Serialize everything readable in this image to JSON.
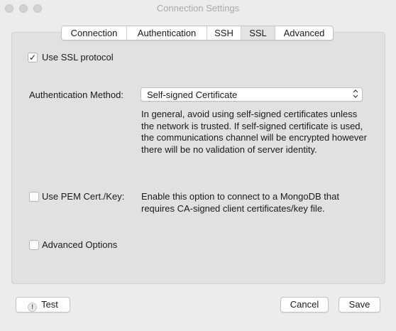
{
  "window": {
    "title": "Connection Settings"
  },
  "tabs": [
    {
      "label": "Connection"
    },
    {
      "label": "Authentication"
    },
    {
      "label": "SSH"
    },
    {
      "label": "SSL"
    },
    {
      "label": "Advanced"
    }
  ],
  "active_tab": "SSL",
  "ssl": {
    "use_ssl_label": "Use SSL protocol",
    "use_ssl_checked": true,
    "auth_method_label": "Authentication Method:",
    "auth_method_value": "Self-signed Certificate",
    "auth_method_help": "In general, avoid using self-signed certificates unless the network is trusted. If self-signed certificate is used, the communications channel will be encrypted however there will be no validation of server identity.",
    "pem_label": "Use PEM Cert./Key:",
    "pem_checked": false,
    "pem_help": "Enable this option to connect to a MongoDB that requires CA-signed client certificates/key file.",
    "advanced_label": "Advanced Options",
    "advanced_checked": false
  },
  "footer": {
    "test_label": "Test",
    "cancel_label": "Cancel",
    "save_label": "Save"
  },
  "icons": {
    "check": "✓",
    "chevron": "⌃⌄",
    "warning": "!"
  }
}
